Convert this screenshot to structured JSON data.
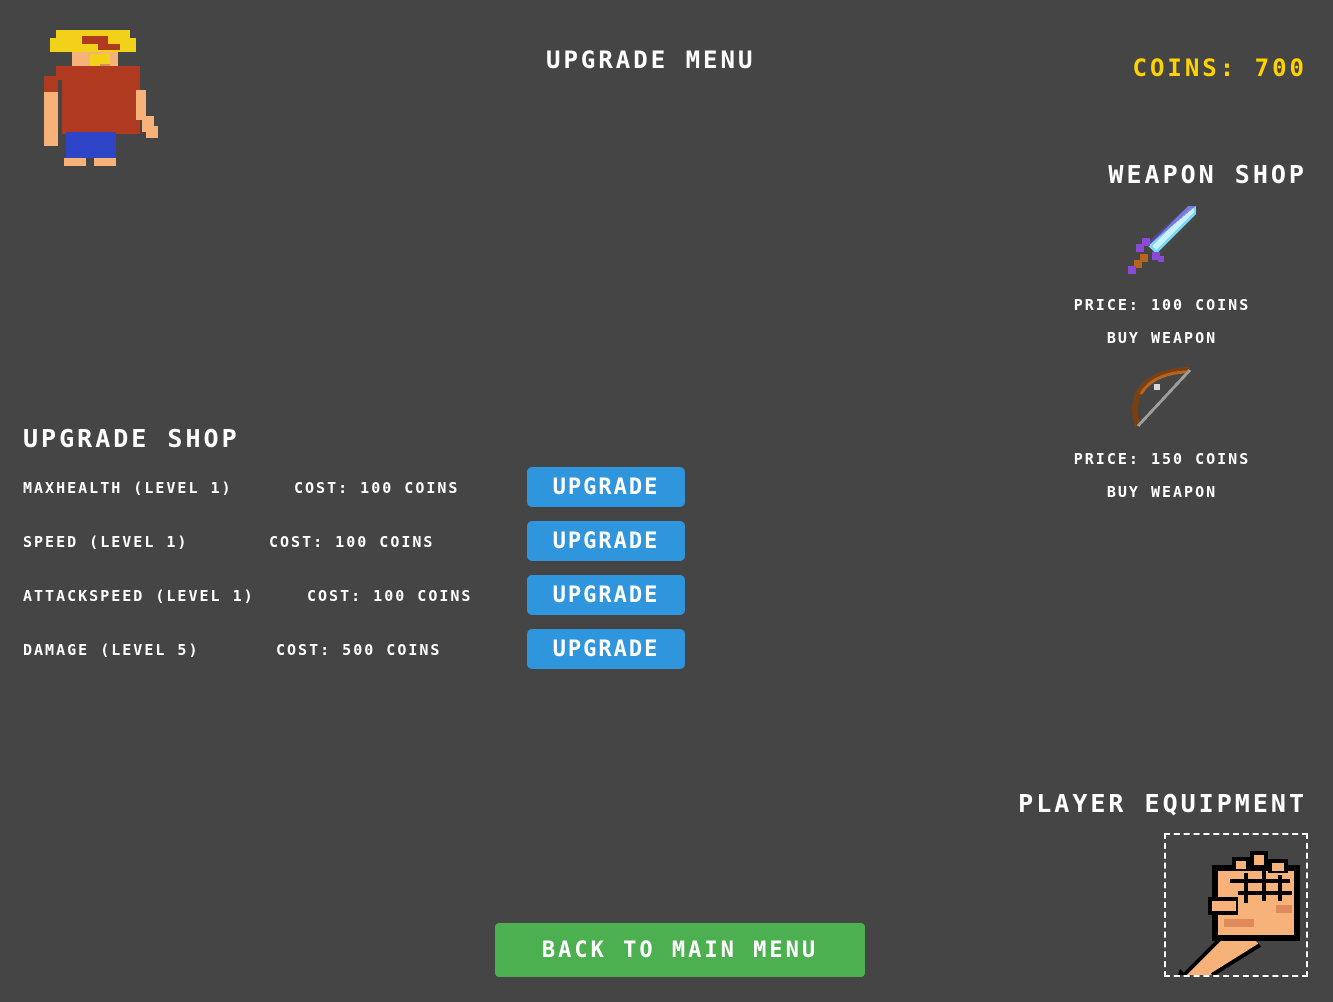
{
  "header": {
    "title": "UPGRADE MENU",
    "coins_label": "COINS: 700"
  },
  "player": {
    "avatar_icon": "player-character-icon"
  },
  "weapon_shop": {
    "title": "WEAPON SHOP",
    "items": [
      {
        "icon": "sword-icon",
        "price_label": "PRICE: 100 COINS",
        "buy_label": "BUY WEAPON"
      },
      {
        "icon": "bow-icon",
        "price_label": "PRICE: 150 COINS",
        "buy_label": "BUY WEAPON"
      }
    ]
  },
  "upgrade_shop": {
    "title": "UPGRADE SHOP",
    "rows": [
      {
        "name": "MAXHEALTH (LEVEL 1)",
        "cost": "COST: 100 COINS",
        "button": "UPGRADE"
      },
      {
        "name": "SPEED (LEVEL 1)",
        "cost": "COST: 100 COINS",
        "button": "UPGRADE"
      },
      {
        "name": "ATTACKSPEED (LEVEL 1)",
        "cost": "COST: 100 COINS",
        "button": "UPGRADE"
      },
      {
        "name": "DAMAGE (LEVEL 5)",
        "cost": "COST: 500 COINS",
        "button": "UPGRADE"
      }
    ]
  },
  "equipment": {
    "title": "PLAYER EQUIPMENT",
    "equipped_icon": "fist-icon"
  },
  "footer": {
    "back_label": "BACK TO MAIN MENU"
  },
  "colors": {
    "background": "#454545",
    "coins": "#ffd200",
    "upgrade_button": "#2f96dd",
    "back_button": "#4caf50"
  }
}
